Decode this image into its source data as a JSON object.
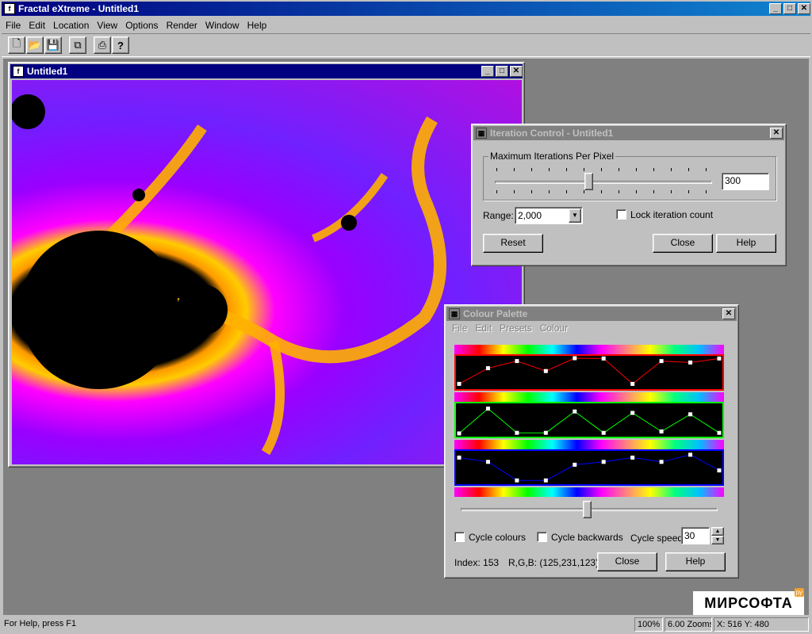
{
  "app": {
    "title": "Fractal eXtreme - Untitled1"
  },
  "menu": [
    "File",
    "Edit",
    "Location",
    "View",
    "Options",
    "Render",
    "Window",
    "Help"
  ],
  "toolbar": {
    "icons": [
      "new-icon",
      "open-icon",
      "save-icon",
      "copy-icon",
      "print-icon",
      "help-icon"
    ]
  },
  "doc": {
    "title": "Untitled1"
  },
  "iteration": {
    "title": "Iteration Control - Untitled1",
    "group_label": "Maximum Iterations Per Pixel",
    "max_iter": "300",
    "slider_level": 0.43,
    "range_label": "Range:",
    "range_value": "2,000",
    "lock_label": "Lock iteration count",
    "reset": "Reset",
    "close": "Close",
    "help": "Help"
  },
  "palette": {
    "title": "Colour Palette",
    "menu": [
      "File",
      "Edit",
      "Presets",
      "Colour"
    ],
    "channels": [
      {
        "name": "red",
        "color": "#ff0000",
        "values": [
          0.9,
          0.35,
          0.1,
          0.45,
          0.0,
          0.01,
          0.9,
          0.1,
          0.15,
          0.01
        ]
      },
      {
        "name": "green",
        "color": "#00ff00",
        "values": [
          0.97,
          0.1,
          0.95,
          0.95,
          0.2,
          0.95,
          0.25,
          0.9,
          0.3,
          0.95
        ]
      },
      {
        "name": "blue",
        "color": "#0000ff",
        "values": [
          0.15,
          0.3,
          0.95,
          0.95,
          0.4,
          0.3,
          0.15,
          0.3,
          0.05,
          0.6
        ]
      }
    ],
    "slider_level": 0.49,
    "cycle_colours": "Cycle colours",
    "cycle_backwards": "Cycle backwards",
    "cycle_speed_label": "Cycle speed:",
    "cycle_speed": "30",
    "index_text": "Index: 153",
    "rgb_text": "R,G,B: (125,231,123)",
    "close": "Close",
    "help": "Help"
  },
  "status": {
    "help": "For Help, press F1",
    "zoom": "100%",
    "zooms": "6.00 Zooms",
    "coords": "X: 516 Y: 480"
  },
  "watermark": {
    "text": "МИРСОФТА",
    "badge": "ру"
  }
}
